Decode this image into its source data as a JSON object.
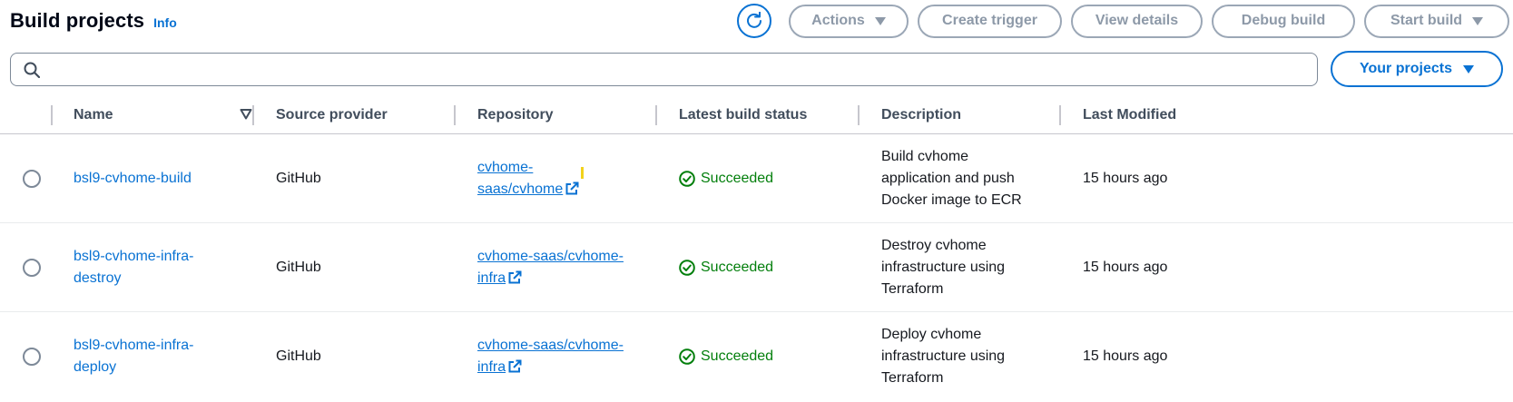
{
  "header": {
    "title": "Build projects",
    "info": "Info"
  },
  "toolbar": {
    "actions": "Actions",
    "create_trigger": "Create trigger",
    "view_details": "View details",
    "debug_build": "Debug build",
    "start_build": "Start build"
  },
  "search": {
    "placeholder": "",
    "value": ""
  },
  "filter": {
    "label": "Your projects"
  },
  "columns": {
    "name": "Name",
    "source": "Source provider",
    "repository": "Repository",
    "status": "Latest build status",
    "description": "Description",
    "modified": "Last Modified"
  },
  "rows": [
    {
      "name": [
        "bsl9-cvhome-build"
      ],
      "source": "GitHub",
      "repo": [
        "cvhome-",
        "saas/cvhome"
      ],
      "status": "Succeeded",
      "description": [
        "Build cvhome",
        "application and push",
        "Docker image to ECR"
      ],
      "modified": "15 hours ago"
    },
    {
      "name": [
        "bsl9-cvhome-infra-",
        "destroy"
      ],
      "source": "GitHub",
      "repo": [
        "cvhome-saas/cvhome-",
        "infra"
      ],
      "status": "Succeeded",
      "description": [
        "Destroy cvhome",
        "infrastructure using",
        "Terraform"
      ],
      "modified": "15 hours ago"
    },
    {
      "name": [
        "bsl9-cvhome-infra-",
        "deploy"
      ],
      "source": "GitHub",
      "repo": [
        "cvhome-saas/cvhome-",
        "infra"
      ],
      "status": "Succeeded",
      "description": [
        "Deploy cvhome",
        "infrastructure using",
        "Terraform"
      ],
      "modified": "15 hours ago"
    }
  ],
  "icons": {
    "refresh": "refresh-icon",
    "search": "search-icon",
    "sort": "sort-descending-icon",
    "external": "external-link-icon",
    "success": "status-success-icon"
  },
  "colors": {
    "link": "#0972d3",
    "success": "#037f0c",
    "disabled": "#8d99a8",
    "heading": "#000716"
  }
}
